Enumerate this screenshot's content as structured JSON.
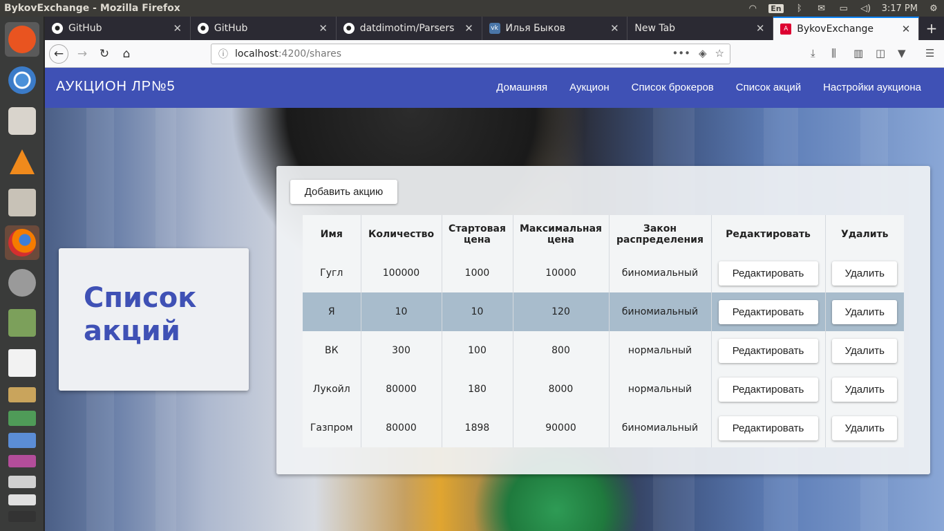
{
  "os": {
    "window_title": "BykovExchange - Mozilla Firefox",
    "lang": "En",
    "time": "3:17 PM"
  },
  "browser": {
    "tabs": [
      {
        "label": "GitHub",
        "icon": "github-icon"
      },
      {
        "label": "GitHub",
        "icon": "github-icon"
      },
      {
        "label": "datdimotim/Parsers",
        "icon": "github-icon"
      },
      {
        "label": "Илья Быков",
        "icon": "vk-icon"
      },
      {
        "label": "New Tab",
        "icon": ""
      },
      {
        "label": "BykovExchange",
        "icon": "angular-icon",
        "active": true
      }
    ],
    "url_host": "localhost",
    "url_path": ":4200/shares"
  },
  "app": {
    "brand_part1": "АУКЦИОН",
    "brand_part2": "ЛР№5",
    "nav": [
      "Домашняя",
      "Аукцион",
      "Список брокеров",
      "Список акций",
      "Настройки аукциона"
    ],
    "page_title": "Список акций",
    "add_button": "Добавить акцию",
    "table": {
      "headers": [
        "Имя",
        "Количество",
        "Стартовая цена",
        "Максимальная цена",
        "Закон распределения",
        "Редактировать",
        "Удалить"
      ],
      "rows": [
        {
          "name": "Гугл",
          "qty": "100000",
          "start": "1000",
          "max": "10000",
          "law": "биномиальный",
          "edit": "Редактировать",
          "del": "Удалить"
        },
        {
          "name": "Я",
          "qty": "10",
          "start": "10",
          "max": "120",
          "law": "биномиальный",
          "edit": "Редактировать",
          "del": "Удалить",
          "highlight": true
        },
        {
          "name": "ВК",
          "qty": "300",
          "start": "100",
          "max": "800",
          "law": "нормальный",
          "edit": "Редактировать",
          "del": "Удалить"
        },
        {
          "name": "Лукойл",
          "qty": "80000",
          "start": "180",
          "max": "8000",
          "law": "нормальный",
          "edit": "Редактировать",
          "del": "Удалить"
        },
        {
          "name": "Газпром",
          "qty": "80000",
          "start": "1898",
          "max": "90000",
          "law": "биномиальный",
          "edit": "Редактировать",
          "del": "Удалить"
        }
      ]
    },
    "colors": {
      "primary": "#3f51b5",
      "highlight_row": "#a8bccc"
    }
  }
}
